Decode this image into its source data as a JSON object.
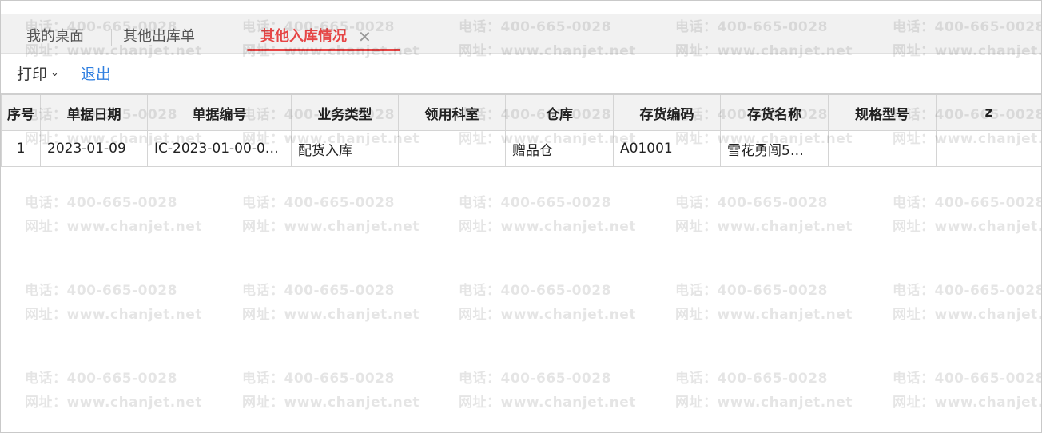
{
  "tabs": [
    {
      "label": "我的桌面",
      "active": false
    },
    {
      "label": "其他出库单",
      "active": false
    },
    {
      "label": "其他入库情况",
      "active": true
    }
  ],
  "tab_close_glyph": "✕",
  "toolbar": {
    "print_label": "打印",
    "print_caret": "⌄",
    "exit_label": "退出"
  },
  "table": {
    "columns": [
      "序号",
      "单据日期",
      "单据编号",
      "业务类型",
      "领用科室",
      "仓库",
      "存货编码",
      "存货名称",
      "规格型号",
      "z"
    ],
    "rows": [
      [
        "1",
        "2023-01-09",
        "IC-2023-01-00-0…",
        "配货入库",
        "",
        "赠品仓",
        "A01001",
        "雪花勇闯5…",
        "",
        ""
      ]
    ]
  },
  "watermark": {
    "phone": "电话：400-665-0028",
    "site": "网址：www.chanjet.net"
  },
  "colors": {
    "accent": "#e64545",
    "link": "#2f7fe0"
  }
}
